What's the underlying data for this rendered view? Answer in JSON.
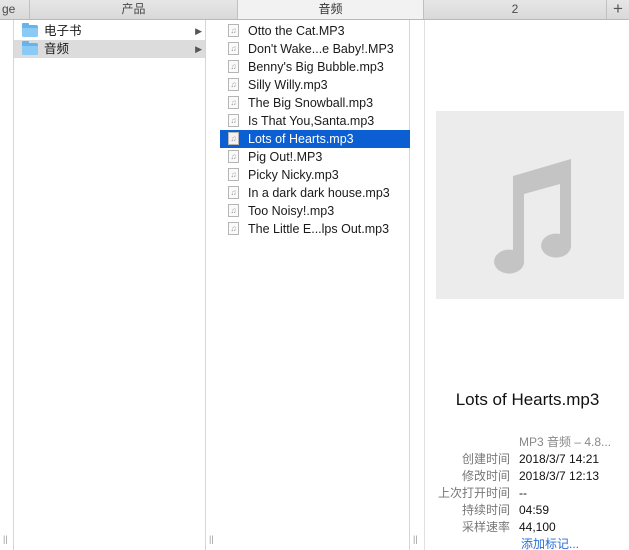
{
  "tabs": [
    {
      "label": "ge"
    },
    {
      "label": "产品"
    },
    {
      "label": "音频"
    },
    {
      "label": "2"
    }
  ],
  "add_tab_label": "+",
  "folders": [
    {
      "label": "电子书",
      "selected": false
    },
    {
      "label": "音频",
      "selected": true
    }
  ],
  "files": [
    {
      "label": "Otto the Cat.MP3"
    },
    {
      "label": "Don't Wake...e Baby!.MP3"
    },
    {
      "label": "Benny's Big Bubble.mp3"
    },
    {
      "label": "Silly Willy.mp3"
    },
    {
      "label": "The Big Snowball.mp3"
    },
    {
      "label": "Is That You,Santa.mp3"
    },
    {
      "label": "Lots of Hearts.mp3",
      "selected": true
    },
    {
      "label": "Pig Out!.MP3"
    },
    {
      "label": "Picky Nicky.mp3"
    },
    {
      "label": "In a dark dark house.mp3"
    },
    {
      "label": "Too Noisy!.mp3"
    },
    {
      "label": "The Little E...lps Out.mp3"
    }
  ],
  "preview": {
    "title": "Lots of Hearts.mp3",
    "kind": "MP3 音频 – 4.8...",
    "info": [
      {
        "key": "创建时间",
        "value": "2018/3/7 14:21"
      },
      {
        "key": "修改时间",
        "value": "2018/3/7 12:13"
      },
      {
        "key": "上次打开时间",
        "value": "--"
      },
      {
        "key": "持续时间",
        "value": "04:59"
      },
      {
        "key": "采样速率",
        "value": "44,100"
      }
    ],
    "add_tags": "添加标记..."
  },
  "resize_handle": "||",
  "colors": {
    "selection": "#0b5fd3",
    "folder": "#66b3ee",
    "link": "#2a6fd6"
  }
}
